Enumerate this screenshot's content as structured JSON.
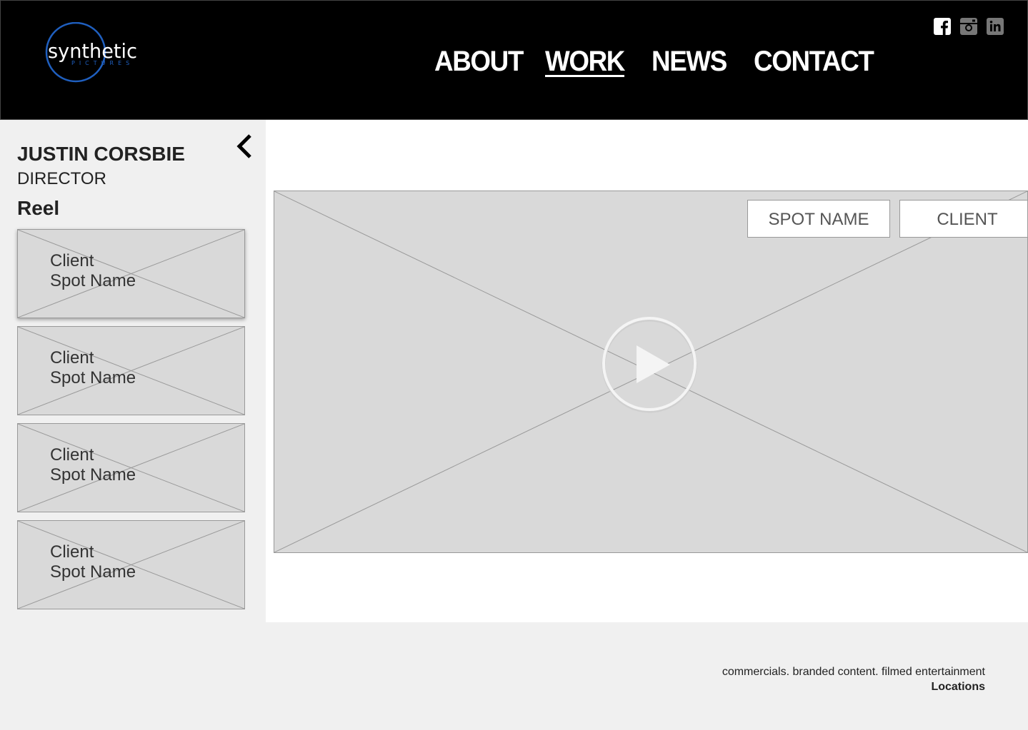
{
  "brand": {
    "logo_word": "synthetic",
    "logo_sub": "PICTURES",
    "accent": "#1f5fbf"
  },
  "nav": {
    "items": [
      {
        "label": "ABOUT",
        "active": false
      },
      {
        "label": "WORK",
        "active": true
      },
      {
        "label": "NEWS",
        "active": false
      },
      {
        "label": "CONTACT",
        "active": false
      }
    ]
  },
  "social": [
    "facebook-icon",
    "instagram-icon",
    "linkedin-icon"
  ],
  "sidebar": {
    "director_name": "JUSTIN CORSBIE",
    "director_role": "DIRECTOR",
    "reel_title": "Reel",
    "reels": [
      {
        "client": "Client",
        "spot": "Spot Name",
        "selected": true
      },
      {
        "client": "Client",
        "spot": "Spot Name",
        "selected": false
      },
      {
        "client": "Client",
        "spot": "Spot Name",
        "selected": false
      },
      {
        "client": "Client",
        "spot": "Spot Name",
        "selected": false
      }
    ]
  },
  "player": {
    "spot_tag": "SPOT NAME",
    "client_tag": "CLIENT"
  },
  "footer": {
    "tagline": "commercials. branded content. filmed entertainment",
    "locations": "Locations"
  },
  "colors": {
    "header_bg": "#000000",
    "placeholder_gray": "#d9d9d9",
    "page_bg": "#f0f0f0"
  }
}
